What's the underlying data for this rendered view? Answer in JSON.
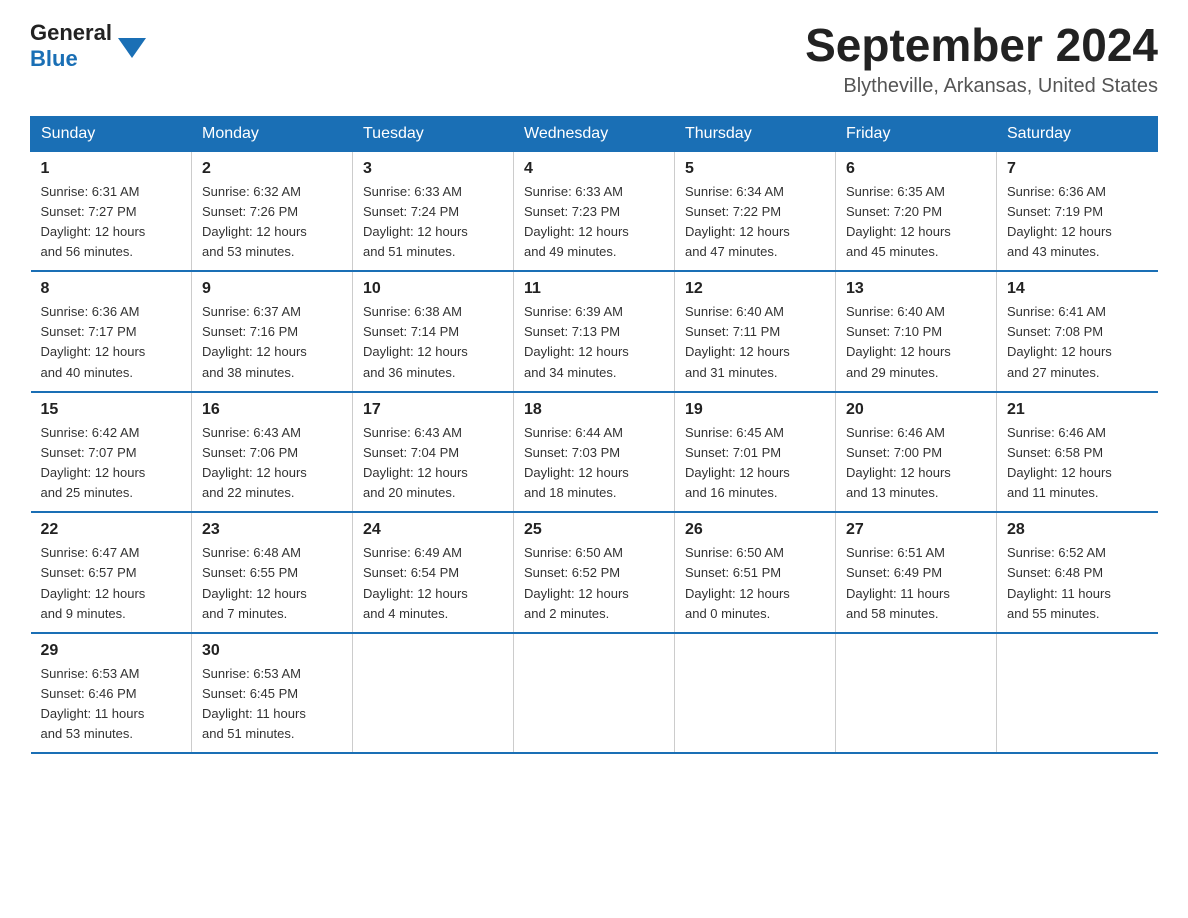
{
  "header": {
    "logo_general": "General",
    "logo_blue": "Blue",
    "month_title": "September 2024",
    "location": "Blytheville, Arkansas, United States"
  },
  "days_of_week": [
    "Sunday",
    "Monday",
    "Tuesday",
    "Wednesday",
    "Thursday",
    "Friday",
    "Saturday"
  ],
  "weeks": [
    [
      {
        "day": "1",
        "sunrise": "6:31 AM",
        "sunset": "7:27 PM",
        "daylight": "12 hours and 56 minutes."
      },
      {
        "day": "2",
        "sunrise": "6:32 AM",
        "sunset": "7:26 PM",
        "daylight": "12 hours and 53 minutes."
      },
      {
        "day": "3",
        "sunrise": "6:33 AM",
        "sunset": "7:24 PM",
        "daylight": "12 hours and 51 minutes."
      },
      {
        "day": "4",
        "sunrise": "6:33 AM",
        "sunset": "7:23 PM",
        "daylight": "12 hours and 49 minutes."
      },
      {
        "day": "5",
        "sunrise": "6:34 AM",
        "sunset": "7:22 PM",
        "daylight": "12 hours and 47 minutes."
      },
      {
        "day": "6",
        "sunrise": "6:35 AM",
        "sunset": "7:20 PM",
        "daylight": "12 hours and 45 minutes."
      },
      {
        "day": "7",
        "sunrise": "6:36 AM",
        "sunset": "7:19 PM",
        "daylight": "12 hours and 43 minutes."
      }
    ],
    [
      {
        "day": "8",
        "sunrise": "6:36 AM",
        "sunset": "7:17 PM",
        "daylight": "12 hours and 40 minutes."
      },
      {
        "day": "9",
        "sunrise": "6:37 AM",
        "sunset": "7:16 PM",
        "daylight": "12 hours and 38 minutes."
      },
      {
        "day": "10",
        "sunrise": "6:38 AM",
        "sunset": "7:14 PM",
        "daylight": "12 hours and 36 minutes."
      },
      {
        "day": "11",
        "sunrise": "6:39 AM",
        "sunset": "7:13 PM",
        "daylight": "12 hours and 34 minutes."
      },
      {
        "day": "12",
        "sunrise": "6:40 AM",
        "sunset": "7:11 PM",
        "daylight": "12 hours and 31 minutes."
      },
      {
        "day": "13",
        "sunrise": "6:40 AM",
        "sunset": "7:10 PM",
        "daylight": "12 hours and 29 minutes."
      },
      {
        "day": "14",
        "sunrise": "6:41 AM",
        "sunset": "7:08 PM",
        "daylight": "12 hours and 27 minutes."
      }
    ],
    [
      {
        "day": "15",
        "sunrise": "6:42 AM",
        "sunset": "7:07 PM",
        "daylight": "12 hours and 25 minutes."
      },
      {
        "day": "16",
        "sunrise": "6:43 AM",
        "sunset": "7:06 PM",
        "daylight": "12 hours and 22 minutes."
      },
      {
        "day": "17",
        "sunrise": "6:43 AM",
        "sunset": "7:04 PM",
        "daylight": "12 hours and 20 minutes."
      },
      {
        "day": "18",
        "sunrise": "6:44 AM",
        "sunset": "7:03 PM",
        "daylight": "12 hours and 18 minutes."
      },
      {
        "day": "19",
        "sunrise": "6:45 AM",
        "sunset": "7:01 PM",
        "daylight": "12 hours and 16 minutes."
      },
      {
        "day": "20",
        "sunrise": "6:46 AM",
        "sunset": "7:00 PM",
        "daylight": "12 hours and 13 minutes."
      },
      {
        "day": "21",
        "sunrise": "6:46 AM",
        "sunset": "6:58 PM",
        "daylight": "12 hours and 11 minutes."
      }
    ],
    [
      {
        "day": "22",
        "sunrise": "6:47 AM",
        "sunset": "6:57 PM",
        "daylight": "12 hours and 9 minutes."
      },
      {
        "day": "23",
        "sunrise": "6:48 AM",
        "sunset": "6:55 PM",
        "daylight": "12 hours and 7 minutes."
      },
      {
        "day": "24",
        "sunrise": "6:49 AM",
        "sunset": "6:54 PM",
        "daylight": "12 hours and 4 minutes."
      },
      {
        "day": "25",
        "sunrise": "6:50 AM",
        "sunset": "6:52 PM",
        "daylight": "12 hours and 2 minutes."
      },
      {
        "day": "26",
        "sunrise": "6:50 AM",
        "sunset": "6:51 PM",
        "daylight": "12 hours and 0 minutes."
      },
      {
        "day": "27",
        "sunrise": "6:51 AM",
        "sunset": "6:49 PM",
        "daylight": "11 hours and 58 minutes."
      },
      {
        "day": "28",
        "sunrise": "6:52 AM",
        "sunset": "6:48 PM",
        "daylight": "11 hours and 55 minutes."
      }
    ],
    [
      {
        "day": "29",
        "sunrise": "6:53 AM",
        "sunset": "6:46 PM",
        "daylight": "11 hours and 53 minutes."
      },
      {
        "day": "30",
        "sunrise": "6:53 AM",
        "sunset": "6:45 PM",
        "daylight": "11 hours and 51 minutes."
      },
      null,
      null,
      null,
      null,
      null
    ]
  ]
}
